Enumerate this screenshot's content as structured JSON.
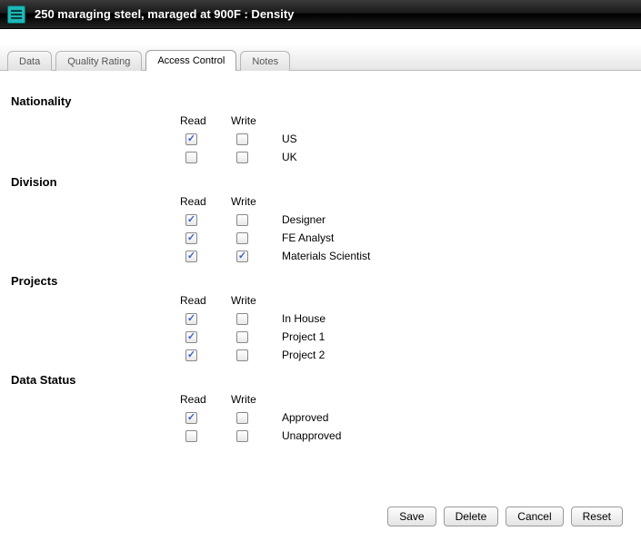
{
  "header": {
    "title": "250 maraging steel, maraged at 900F : Density"
  },
  "tabs": [
    {
      "label": "Data",
      "active": false
    },
    {
      "label": "Quality Rating",
      "active": false
    },
    {
      "label": "Access Control",
      "active": true
    },
    {
      "label": "Notes",
      "active": false
    }
  ],
  "columns": {
    "read": "Read",
    "write": "Write"
  },
  "sections": [
    {
      "title": "Nationality",
      "rows": [
        {
          "label": "US",
          "read": true,
          "write": false
        },
        {
          "label": "UK",
          "read": false,
          "write": false
        }
      ]
    },
    {
      "title": "Division",
      "rows": [
        {
          "label": "Designer",
          "read": true,
          "write": false
        },
        {
          "label": "FE Analyst",
          "read": true,
          "write": false
        },
        {
          "label": "Materials Scientist",
          "read": true,
          "write": true
        }
      ]
    },
    {
      "title": "Projects",
      "rows": [
        {
          "label": "In House",
          "read": true,
          "write": false
        },
        {
          "label": "Project 1",
          "read": true,
          "write": false
        },
        {
          "label": "Project 2",
          "read": true,
          "write": false
        }
      ]
    },
    {
      "title": "Data Status",
      "rows": [
        {
          "label": "Approved",
          "read": true,
          "write": false
        },
        {
          "label": "Unapproved",
          "read": false,
          "write": false
        }
      ]
    }
  ],
  "buttons": {
    "save": "Save",
    "delete": "Delete",
    "cancel": "Cancel",
    "reset": "Reset"
  }
}
